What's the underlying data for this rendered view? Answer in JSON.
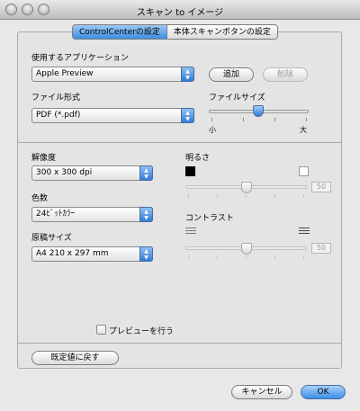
{
  "window": {
    "title": "スキャン to イメージ"
  },
  "tabs": [
    {
      "label": "ControlCenterの設定"
    },
    {
      "label": "本体スキャンボタンの設定"
    }
  ],
  "application": {
    "label": "使用するアプリケーション",
    "value": "Apple Preview",
    "add_button": "追加",
    "delete_button": "削除"
  },
  "file_type": {
    "label": "ファイル形式",
    "value": "PDF (*.pdf)"
  },
  "file_size": {
    "label": "ファイルサイズ",
    "small_label": "小",
    "large_label": "大",
    "level": 0.5
  },
  "resolution": {
    "label": "解像度",
    "value": "300 x 300 dpi"
  },
  "color": {
    "label": "色数",
    "value": "24ﾋﾞｯﾄｶﾗｰ"
  },
  "document_size": {
    "label": "原稿サイズ",
    "value": "A4  210 x 297 mm"
  },
  "brightness": {
    "label": "明るさ",
    "value": "50"
  },
  "contrast": {
    "label": "コントラスト",
    "value": "50"
  },
  "preview": {
    "label": "プレビューを行う",
    "checked": false
  },
  "restore_defaults_button": "既定値に戻す",
  "cancel_button": "キャンセル",
  "ok_button": "OK",
  "colors": {
    "accent": "#3d8ee5",
    "background": "#e8e8e8"
  }
}
